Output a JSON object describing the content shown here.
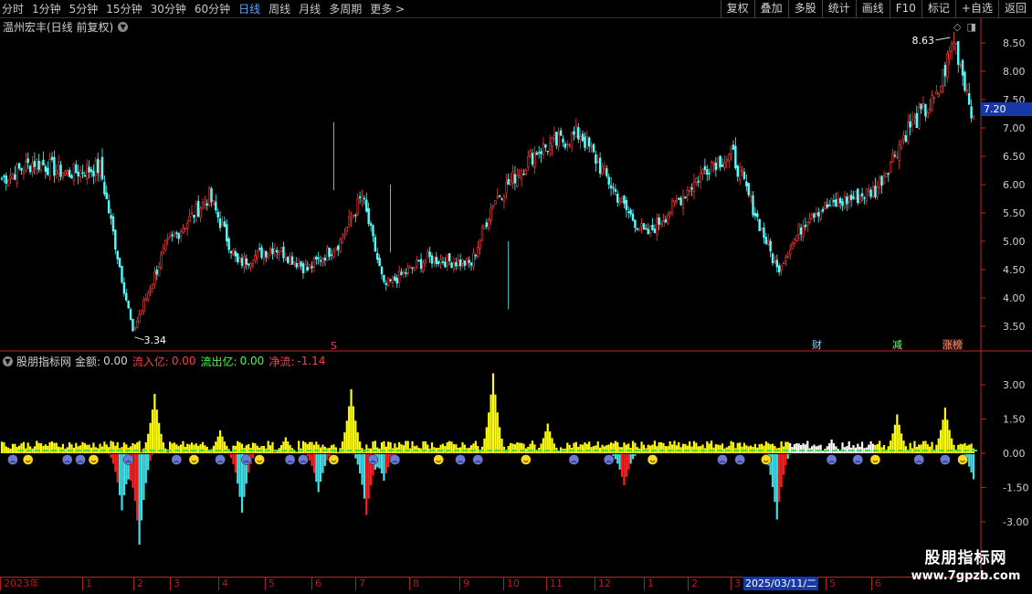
{
  "toolbar": {
    "periods": [
      {
        "label": "分时",
        "active": false
      },
      {
        "label": "1分钟",
        "active": false
      },
      {
        "label": "5分钟",
        "active": false
      },
      {
        "label": "15分钟",
        "active": false
      },
      {
        "label": "30分钟",
        "active": false
      },
      {
        "label": "60分钟",
        "active": false
      },
      {
        "label": "日线",
        "active": true
      },
      {
        "label": "周线",
        "active": false
      },
      {
        "label": "月线",
        "active": false
      },
      {
        "label": "多周期",
        "active": false
      },
      {
        "label": "更多 >",
        "active": false
      }
    ],
    "tools": [
      "复权",
      "叠加",
      "多股",
      "统计",
      "画线",
      "F10",
      "标记",
      "+自选",
      "返回"
    ]
  },
  "main_panel": {
    "title": "温州宏丰(日线 前复权)",
    "high_label": "8.63",
    "low_label": "3.34",
    "last_price": "7.20",
    "price_ticks": [
      "8.50",
      "8.00",
      "7.50",
      "7.00",
      "6.50",
      "6.00",
      "5.50",
      "5.00",
      "4.50",
      "4.00",
      "3.50"
    ],
    "annotations": {
      "cai": "财",
      "jian": "减",
      "zhangbang": "涨榜",
      "s": "S"
    }
  },
  "indicator_panel": {
    "name": "股朋指标网",
    "amount_label": "金额:",
    "amount_value": "0.00",
    "inflow_label": "流入亿:",
    "inflow_value": "0.00",
    "outflow_label": "流出亿:",
    "outflow_value": "0.00",
    "net_label": "净流:",
    "net_value": "-1.14",
    "ticks": [
      "3.00",
      "1.50",
      "0.00",
      "-1.50",
      "-3.00"
    ]
  },
  "date_axis": {
    "labels": [
      "2023年",
      "1",
      "2",
      "3",
      "4",
      "5",
      "6",
      "7",
      "8",
      "9",
      "10",
      "11",
      "12",
      "1",
      "2",
      "3",
      "4",
      "5",
      "6"
    ],
    "cursor_date": "2025/03/11/二"
  },
  "watermark": {
    "title": "股朋指标网",
    "url": "www.7gpzb.com"
  },
  "colors": {
    "up": "#ff3c3c",
    "down": "#54ffff",
    "inflow": "#ffff00",
    "outflow_red": "#ff1e1e",
    "outflow_cyan": "#40e0e8",
    "axis": "#c02828",
    "accent": "#1838a8"
  },
  "chart_data": [
    {
      "type": "candlestick",
      "title": "温州宏丰(日线 前复权)",
      "ylim": [
        3.3,
        8.8
      ],
      "key_points": [
        {
          "i": 0,
          "close": 6.1
        },
        {
          "i": 15,
          "close": 6.4
        },
        {
          "i": 30,
          "close": 6.2
        },
        {
          "i": 45,
          "close": 6.3
        },
        {
          "i": 60,
          "close": 3.4
        },
        {
          "i": 75,
          "close": 4.9
        },
        {
          "i": 95,
          "close": 5.8
        },
        {
          "i": 108,
          "close": 4.6
        },
        {
          "i": 125,
          "close": 4.9
        },
        {
          "i": 140,
          "close": 4.5
        },
        {
          "i": 155,
          "close": 5.0
        },
        {
          "i": 165,
          "close": 5.8
        },
        {
          "i": 175,
          "close": 4.2
        },
        {
          "i": 195,
          "close": 4.7
        },
        {
          "i": 215,
          "close": 4.6
        },
        {
          "i": 225,
          "close": 5.7
        },
        {
          "i": 245,
          "close": 6.6
        },
        {
          "i": 265,
          "close": 6.9
        },
        {
          "i": 285,
          "close": 5.6
        },
        {
          "i": 295,
          "close": 5.1
        },
        {
          "i": 305,
          "close": 5.5
        },
        {
          "i": 325,
          "close": 6.4
        },
        {
          "i": 335,
          "close": 6.5
        },
        {
          "i": 355,
          "close": 4.5
        },
        {
          "i": 370,
          "close": 5.5
        },
        {
          "i": 385,
          "close": 5.7
        },
        {
          "i": 400,
          "close": 5.9
        },
        {
          "i": 415,
          "close": 7.0
        },
        {
          "i": 428,
          "close": 7.5
        },
        {
          "i": 436,
          "close": 8.6
        },
        {
          "i": 445,
          "close": 7.2
        }
      ],
      "total_bars": 446,
      "high": 8.63,
      "low": 3.34,
      "last": 7.2
    },
    {
      "type": "bar",
      "title": "股朋指标网",
      "ylim": [
        -4.2,
        4.2
      ],
      "inflow_peaks": [
        {
          "i": 70,
          "value": 2.6
        },
        {
          "i": 100,
          "value": 1.0
        },
        {
          "i": 160,
          "value": 2.8
        },
        {
          "i": 225,
          "value": 3.5
        },
        {
          "i": 250,
          "value": 1.3
        },
        {
          "i": 410,
          "value": 1.7
        },
        {
          "i": 432,
          "value": 2.0
        },
        {
          "i": 380,
          "value": 0.6
        },
        {
          "i": 130,
          "value": 0.7
        }
      ],
      "outflow_troughs": [
        {
          "i": 55,
          "value": -2.5
        },
        {
          "i": 63,
          "value": -4.0
        },
        {
          "i": 110,
          "value": -2.6
        },
        {
          "i": 145,
          "value": -1.7
        },
        {
          "i": 167,
          "value": -2.7
        },
        {
          "i": 175,
          "value": -1.2
        },
        {
          "i": 285,
          "value": -1.4
        },
        {
          "i": 355,
          "value": -2.9
        },
        {
          "i": 445,
          "value": -1.14
        }
      ]
    }
  ]
}
